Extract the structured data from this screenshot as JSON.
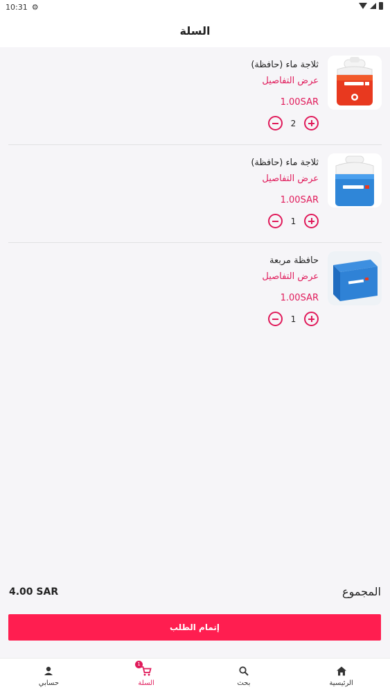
{
  "status_bar": {
    "time": "10:31"
  },
  "header": {
    "title": "السلة"
  },
  "cart": {
    "items": [
      {
        "name": "ثلاجة ماء (حافظة)",
        "details_link": "عرض التفاصيل",
        "price": "1.00SAR",
        "quantity": "2",
        "image": "orange-water-cooler"
      },
      {
        "name": "ثلاجة ماء (حافظة)",
        "details_link": "عرض التفاصيل",
        "price": "1.00SAR",
        "quantity": "1",
        "image": "blue-water-cooler"
      },
      {
        "name": "حافظة مربعة",
        "details_link": "عرض التفاصيل",
        "price": "1.00SAR",
        "quantity": "1",
        "image": "blue-square-cooler-box"
      }
    ]
  },
  "summary": {
    "total_label": "المجموع",
    "total_value": "4.00 SAR"
  },
  "checkout": {
    "label": "إتمام الطلب"
  },
  "bottom_nav": {
    "profile": "حسابي",
    "cart": "السلة",
    "cart_badge": "1",
    "search": "بحث",
    "home": "الرئيسية"
  },
  "colors": {
    "accent": "#e01a5a",
    "button": "#ff1e50",
    "background": "#f6f5f8"
  }
}
